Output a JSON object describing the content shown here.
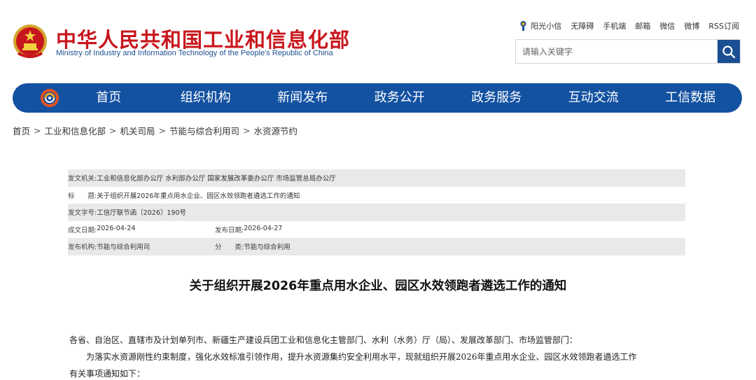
{
  "site": {
    "title_cn": "中华人民共和国工业和信息化部",
    "title_en": "Ministry of Industry and Information Technology of the People's Republic of China"
  },
  "toplinks": [
    {
      "label": "阳光小信",
      "icon": "sunlight-icon"
    },
    {
      "label": "无障碍"
    },
    {
      "label": "手机端"
    },
    {
      "label": "邮箱"
    },
    {
      "label": "微信"
    },
    {
      "label": "微博"
    },
    {
      "label": "RSS订阅"
    }
  ],
  "search": {
    "placeholder": "请输入关键字",
    "icon": "search-icon"
  },
  "nav": {
    "items": [
      "首页",
      "组织机构",
      "新闻发布",
      "政务公开",
      "政务服务",
      "互动交流",
      "工信数据"
    ]
  },
  "breadcrumb": [
    "首页",
    "工业和信息化部",
    "机关司局",
    "节能与综合利用司",
    "水资源节约"
  ],
  "meta": {
    "issuer_label": "发文机关:",
    "issuer": "工业和信息化部办公厅 水利部办公厅 国家发展改革委办公厅 市场监管总局办公厅",
    "title_label": "标　　题:",
    "title": "关于组织开展2026年重点用水企业、园区水效领跑者遴选工作的通知",
    "docno_label": "发文字号:",
    "docno": "工信厅联节函〔2026〕190号",
    "created_label": "成文日期:",
    "created": "2026-04-24",
    "published_label": "发布日期:",
    "published": "2026-04-27",
    "org_label": "发布机构:",
    "org": "节能与综合利用司",
    "category_label": "分　　类:",
    "category": "节能与综合利用"
  },
  "article": {
    "title": "关于组织开展2026年重点用水企业、园区水效领跑者遴选工作的通知",
    "salutation": "各省、自治区、直辖市及计划单列市、新疆生产建设兵团工业和信息化主管部门、水利（水务）厅（局）、发展改革部门、市场监管部门：",
    "para1_line1": "为落实水资源刚性约束制度，强化水效标准引领作用，提升水资源集约安全利用水平，现就组织开展2026年重点用水企业、园区水效领跑者遴选工作",
    "para1_line2": "有关事项通知如下："
  },
  "colors": {
    "brand_red": "#c8161d",
    "nav_blue": "#1351a1",
    "search_blue": "#1a4f93",
    "meta_row_gray": "#e9e9e9"
  }
}
